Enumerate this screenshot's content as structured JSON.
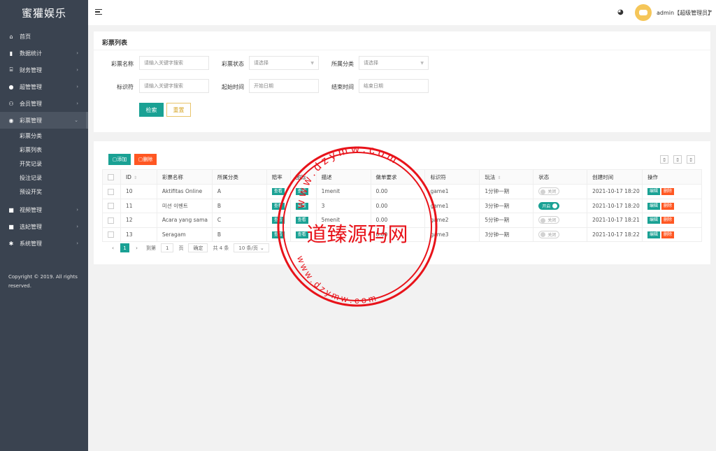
{
  "brand": "蜜獾娱乐",
  "sidebar": {
    "items": [
      {
        "label": "首页",
        "icon": "home-icon",
        "glyph": "⌂",
        "arrow": ""
      },
      {
        "label": "数据统计",
        "icon": "bar-chart-icon",
        "glyph": "▮",
        "arrow": "›"
      },
      {
        "label": "财务管理",
        "icon": "bank-icon",
        "glyph": "⌸",
        "arrow": "›"
      },
      {
        "label": "超管管理",
        "icon": "user-icon",
        "glyph": "●",
        "arrow": "›"
      },
      {
        "label": "会员管理",
        "icon": "users-icon",
        "glyph": "⚇",
        "arrow": "›"
      },
      {
        "label": "彩票管理",
        "icon": "gamepad-icon",
        "glyph": "◉",
        "arrow": "⌄"
      }
    ],
    "subitems": [
      "彩票分类",
      "彩票列表",
      "开奖记录",
      "投注记录",
      "预设开奖"
    ],
    "items_bottom": [
      {
        "label": "视频管理",
        "icon": "video-icon",
        "glyph": "■",
        "arrow": "›"
      },
      {
        "label": "选妃管理",
        "icon": "video-icon",
        "glyph": "■",
        "arrow": "›"
      },
      {
        "label": "系统管理",
        "icon": "gear-icon",
        "glyph": "✱",
        "arrow": "›"
      }
    ],
    "copyright": "Copyright © 2019. All rights reserved."
  },
  "topbar": {
    "user": "admin【超级管理员】",
    "caret": "▾"
  },
  "filter": {
    "title": "彩票列表",
    "name_label": "彩票名称",
    "name_placeholder": "请输入关键字搜索",
    "status_label": "彩票状态",
    "status_value": "请选择",
    "category_label": "所属分类",
    "category_value": "请选择",
    "key_label": "标识符",
    "key_placeholder": "请输入关键字搜索",
    "start_label": "起始时间",
    "start_placeholder": "开始日期",
    "end_label": "结束时间",
    "end_placeholder": "结束日期",
    "search_button": "检索",
    "reset_button": "重置"
  },
  "toolbar": {
    "add_button": "添加",
    "delete_button": "删除"
  },
  "table": {
    "headers": [
      "",
      "ID",
      "彩票名称",
      "所属分类",
      "赔率",
      "图标",
      "描述",
      "做单要求",
      "标识符",
      "玩法",
      "状态",
      "创建时间",
      "操作"
    ],
    "rows": [
      {
        "id": "10",
        "name": "Aktifitas Online",
        "category": "A",
        "odds": "查看",
        "icon": "查看",
        "desc": "1menit",
        "req": "0.00",
        "key": "game1",
        "play": "1分钟一期",
        "status": "关闭",
        "on": false,
        "created": "2021-10-17 18:20"
      },
      {
        "id": "11",
        "name": "미션 이벤트",
        "category": "B",
        "odds": "查看",
        "icon": "查看",
        "desc": "3",
        "req": "0.00",
        "key": "game1",
        "play": "3分钟一期",
        "status": "开启",
        "on": true,
        "created": "2021-10-17 18:20"
      },
      {
        "id": "12",
        "name": "Acara yang sama",
        "category": "C",
        "odds": "查看",
        "icon": "查看",
        "desc": "5menit",
        "req": "0.00",
        "key": "game2",
        "play": "5分钟一期",
        "status": "关闭",
        "on": false,
        "created": "2021-10-17 18:21"
      },
      {
        "id": "13",
        "name": "Seragam",
        "category": "B",
        "odds": "查看",
        "icon": "查看",
        "desc": "",
        "req": "0.00",
        "key": "game3",
        "play": "3分钟一期",
        "status": "关闭",
        "on": false,
        "created": "2021-10-17 18:22"
      }
    ],
    "edit_label": "编辑",
    "delete_label": "删除"
  },
  "pager": {
    "current": "1",
    "goto_label": "到第",
    "page_input": "1",
    "page_unit": "页",
    "confirm": "确定",
    "total": "共 4 条",
    "per_page": "10 条/页"
  },
  "watermark": {
    "center": "道臻源码网",
    "top": "w w w . d z y m w . c o m",
    "bottom": "w w w . d z y m w . c o m"
  },
  "colors": {
    "sidebar_bg": "#3a4350",
    "accent": "#1aa194",
    "danger": "#ff5722",
    "watermark": "#e8131a"
  }
}
